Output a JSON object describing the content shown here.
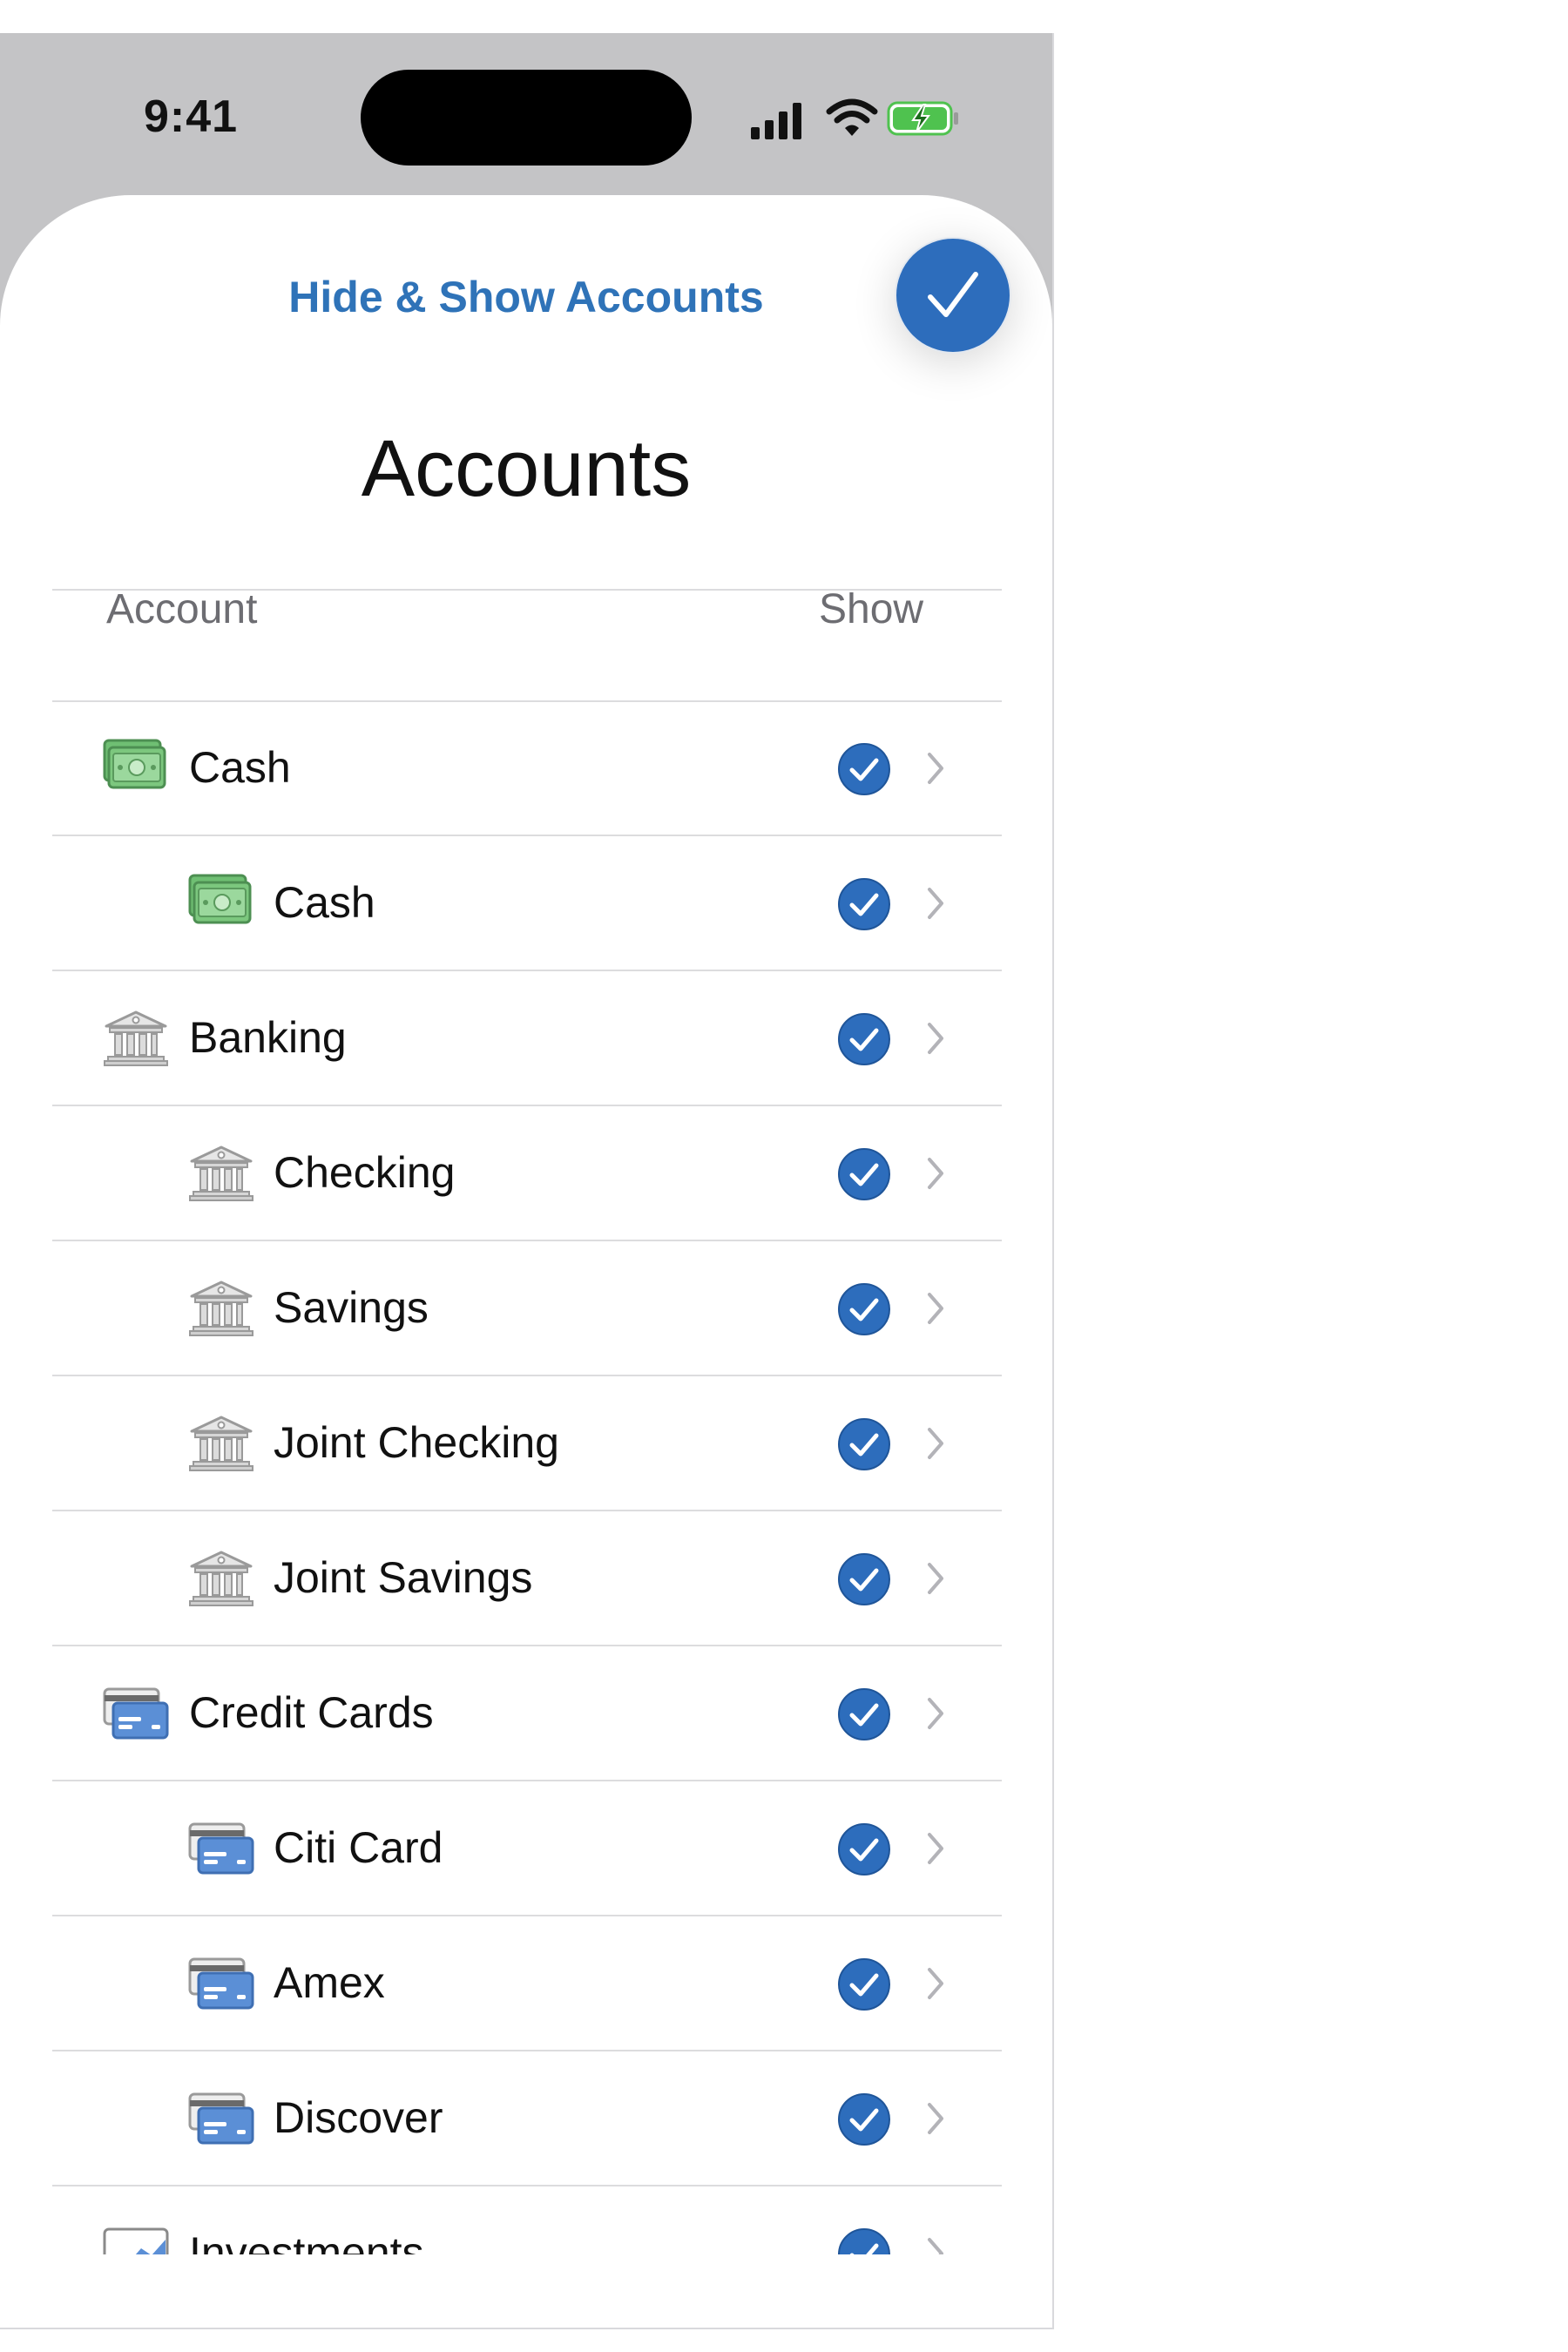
{
  "status_bar": {
    "time": "9:41"
  },
  "sheet": {
    "title": "Hide & Show Accounts",
    "heading": "Accounts"
  },
  "columns": {
    "account": "Account",
    "show": "Show"
  },
  "accounts": [
    {
      "label": "Cash",
      "icon": "cash-icon",
      "level": 0,
      "shown": true
    },
    {
      "label": "Cash",
      "icon": "cash-icon",
      "level": 1,
      "shown": true
    },
    {
      "label": "Banking",
      "icon": "bank-icon",
      "level": 0,
      "shown": true
    },
    {
      "label": "Checking",
      "icon": "bank-icon",
      "level": 1,
      "shown": true
    },
    {
      "label": "Savings",
      "icon": "bank-icon",
      "level": 1,
      "shown": true
    },
    {
      "label": "Joint Checking",
      "icon": "bank-icon",
      "level": 1,
      "shown": true
    },
    {
      "label": "Joint Savings",
      "icon": "bank-icon",
      "level": 1,
      "shown": true
    },
    {
      "label": "Credit Cards",
      "icon": "credit-card-icon",
      "level": 0,
      "shown": true
    },
    {
      "label": "Citi Card",
      "icon": "credit-card-icon",
      "level": 1,
      "shown": true
    },
    {
      "label": "Amex",
      "icon": "credit-card-icon",
      "level": 1,
      "shown": true
    },
    {
      "label": "Discover",
      "icon": "credit-card-icon",
      "level": 1,
      "shown": true
    },
    {
      "label": "Investments",
      "icon": "investment-chart-icon",
      "level": 0,
      "shown": true
    }
  ],
  "colors": {
    "accent": "#2d6dbc",
    "title": "#2f73b8",
    "cash": "#7cc77e",
    "card": "#5b8fd6"
  }
}
